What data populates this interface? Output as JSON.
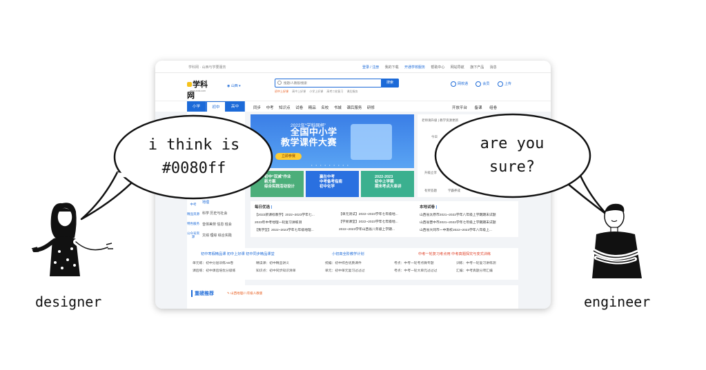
{
  "browser": {
    "topbar": {
      "brand": "学科网",
      "brand_sub": "· 山西与学要服务",
      "links": [
        "登录 / 注册",
        "我的下载",
        "开通学校服务",
        "帮助中心",
        "网站导航",
        "旗下产品",
        "消息"
      ]
    },
    "header": {
      "logo": "学科网",
      "logo_url": "www.zxxk.com",
      "region": "山西",
      "search_placeholder": "搜题/人教版/搜索",
      "search_button": "搜索",
      "hotwords": [
        "初中上好课",
        "高中上好课",
        "小学上好课",
        "高考二轮复习",
        "课后服务"
      ],
      "icons": [
        "网校通",
        "会员",
        "上传"
      ]
    },
    "nav": {
      "stages": [
        "小学",
        "初中",
        "高中"
      ],
      "items": [
        "同步",
        "中考",
        "知识点",
        "试卷",
        "精品",
        "名校",
        "书城",
        "课后服务",
        "研修"
      ],
      "right": [
        "开放平台",
        "备课",
        "组卷"
      ]
    },
    "sidebar": {
      "left_col": [
        "名校资源",
        "名师分享",
        "中考",
        "精品资源",
        "特色服务",
        "公众号资源"
      ],
      "rows": [
        "地理",
        "科学  历史与社会",
        "音体美劳  信息  班会",
        "文综  理综  综合实践"
      ]
    },
    "banner": {
      "sub": "2022年“学科网杯”",
      "main_line1": "全国中小学",
      "main_line2": "教学课件大赛",
      "cta": "立即参赛",
      "dots": "• • • • • • • • •"
    },
    "promos": [
      {
        "line1": "初中“双减”作业",
        "line2": "新方案",
        "line3": "综合实践活动设计"
      },
      {
        "line1": "赢在中考",
        "line2": "中考备考指南",
        "line3": "初中化学"
      },
      {
        "line1": "2022-2023",
        "line2": "初中上学期",
        "line3": "期末考点大串讲"
      }
    ],
    "right_panel": {
      "lines": [
        "老师请升级 | 教学资源更新",
        "今日",
        "升级立享",
        "有奖答题",
        "学霸养成",
        "备课组卷"
      ]
    },
    "lists": {
      "daily_title": "每日优选",
      "daily": [
        "【2022新课标教学】2022~2023学年七...",
        "2023年中考地理一轮复习讲练测",
        "【我学堂】2022~2023学年七年级地理..."
      ],
      "daily2": [
        "【单元测试】2022~2023学年七年级地...",
        "【学易课堂】2022~2023学年七年级地...",
        "2022~2023学年山西省八年级上学期..."
      ],
      "local_title": "本地试卷",
      "local": [
        "山西省太原市2021~2022学年八年级上学期期末试题",
        "山西省晋中市2021~2022学年七年级上学期期末试题",
        "山西省大同市一中南校2022~2023学年八年级上..."
      ]
    },
    "promo_links": {
      "h1": "初中寒假精品课  初中上好课  初中同步精品课堂",
      "h2": "小初高全阶教学计划",
      "h3": "中考一轮复习考点用  中考真题探究与变式训练",
      "l1": [
        "单元练：初中分层训练AB卷",
        "课后练：初中课后培优分级练"
      ],
      "l2": [
        "精读课：初中精品讲义",
        "知识点：初中同步知识清单"
      ],
      "l3": [
        "统编：初中综合优质课件",
        "单元：初中单元复习过过过"
      ],
      "l4": [
        "考点：中考一轮考点微专题",
        "考点：中考一轮大单元过过过"
      ],
      "l5": [
        "训练：中考一轮复习讲练测",
        "汇编：中考真题分项汇编"
      ]
    },
    "featured": {
      "title": "重磅推荐",
      "tag": "山西地理/八年级人教版"
    }
  },
  "designer_bubble": {
    "line1": "i think is",
    "line2": "#0080ff"
  },
  "engineer_bubble": {
    "line1": "are you",
    "line2": "sure?"
  },
  "captions": {
    "designer": "designer",
    "engineer": "engineer"
  },
  "colors": {
    "accent": "#1c6ad8",
    "quoted_color": "#0080ff"
  }
}
